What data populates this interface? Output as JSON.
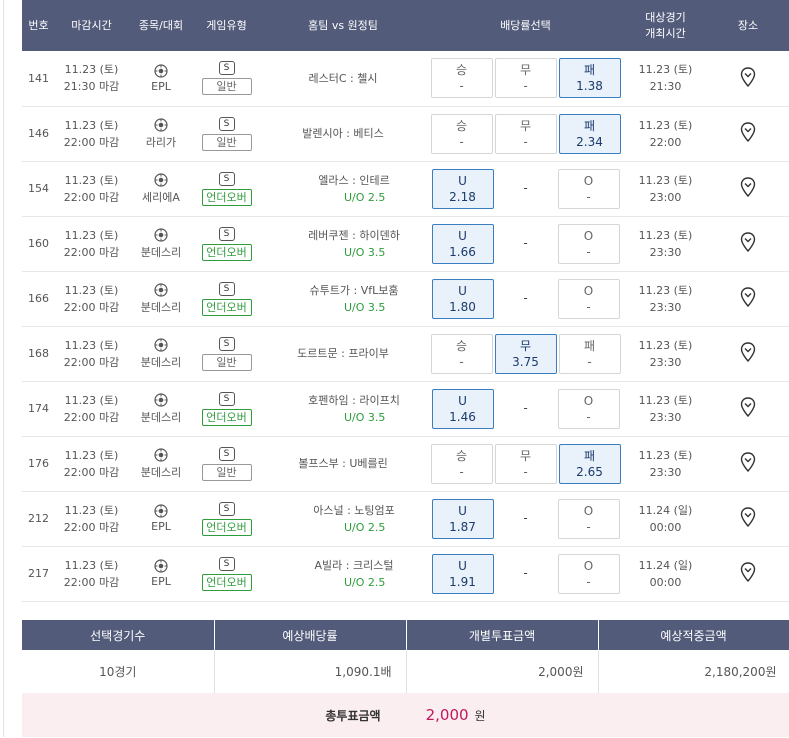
{
  "headers": [
    "번호",
    "마감시간",
    "종목/대회",
    "게임유형",
    "홈팀 vs 원정팀",
    "배당률선택",
    "대상경기\n개최시간",
    "장소"
  ],
  "rows": [
    {
      "no": "141",
      "date": "11.23 (토)",
      "close": "21:30 마감",
      "league": "EPL",
      "type": "일반",
      "match": "레스터C : 첼시",
      "uo": "",
      "odds": [
        {
          "label": "승",
          "value": "-",
          "sel": false
        },
        {
          "label": "무",
          "value": "-",
          "sel": false
        },
        {
          "label": "패",
          "value": "1.38",
          "sel": true
        }
      ],
      "game_date": "11.23 (토)",
      "game_time": "21:30"
    },
    {
      "no": "146",
      "date": "11.23 (토)",
      "close": "22:00 마감",
      "league": "라리가",
      "type": "일반",
      "match": "발렌시아 : 베티스",
      "uo": "",
      "odds": [
        {
          "label": "승",
          "value": "-",
          "sel": false
        },
        {
          "label": "무",
          "value": "-",
          "sel": false
        },
        {
          "label": "패",
          "value": "2.34",
          "sel": true
        }
      ],
      "game_date": "11.23 (토)",
      "game_time": "22:00"
    },
    {
      "no": "154",
      "date": "11.23 (토)",
      "close": "22:00 마감",
      "league": "세리에A",
      "type": "언더오버",
      "match": "엘라스 : 인테르",
      "uo": "U/O 2.5",
      "odds": [
        {
          "label": "U",
          "value": "2.18",
          "sel": true
        },
        {
          "label": "-",
          "value": "",
          "sel": false
        },
        {
          "label": "O",
          "value": "-",
          "sel": false
        }
      ],
      "game_date": "11.23 (토)",
      "game_time": "23:00"
    },
    {
      "no": "160",
      "date": "11.23 (토)",
      "close": "22:00 마감",
      "league": "분데스리",
      "type": "언더오버",
      "match": "레버쿠젠 : 하이덴하",
      "uo": "U/O 3.5",
      "odds": [
        {
          "label": "U",
          "value": "1.66",
          "sel": true
        },
        {
          "label": "-",
          "value": "",
          "sel": false
        },
        {
          "label": "O",
          "value": "-",
          "sel": false
        }
      ],
      "game_date": "11.23 (토)",
      "game_time": "23:30"
    },
    {
      "no": "166",
      "date": "11.23 (토)",
      "close": "22:00 마감",
      "league": "분데스리",
      "type": "언더오버",
      "match": "슈투트가 : VfL보훔",
      "uo": "U/O 3.5",
      "odds": [
        {
          "label": "U",
          "value": "1.80",
          "sel": true
        },
        {
          "label": "-",
          "value": "",
          "sel": false
        },
        {
          "label": "O",
          "value": "-",
          "sel": false
        }
      ],
      "game_date": "11.23 (토)",
      "game_time": "23:30"
    },
    {
      "no": "168",
      "date": "11.23 (토)",
      "close": "22:00 마감",
      "league": "분데스리",
      "type": "일반",
      "match": "도르트문 : 프라이부",
      "uo": "",
      "odds": [
        {
          "label": "승",
          "value": "-",
          "sel": false
        },
        {
          "label": "무",
          "value": "3.75",
          "sel": true
        },
        {
          "label": "패",
          "value": "-",
          "sel": false
        }
      ],
      "game_date": "11.23 (토)",
      "game_time": "23:30"
    },
    {
      "no": "174",
      "date": "11.23 (토)",
      "close": "22:00 마감",
      "league": "분데스리",
      "type": "언더오버",
      "match": "호펜하임 : 라이프치",
      "uo": "U/O 3.5",
      "odds": [
        {
          "label": "U",
          "value": "1.46",
          "sel": true
        },
        {
          "label": "-",
          "value": "",
          "sel": false
        },
        {
          "label": "O",
          "value": "-",
          "sel": false
        }
      ],
      "game_date": "11.23 (토)",
      "game_time": "23:30"
    },
    {
      "no": "176",
      "date": "11.23 (토)",
      "close": "22:00 마감",
      "league": "분데스리",
      "type": "일반",
      "match": "볼프스부 : U베를린",
      "uo": "",
      "odds": [
        {
          "label": "승",
          "value": "-",
          "sel": false
        },
        {
          "label": "무",
          "value": "-",
          "sel": false
        },
        {
          "label": "패",
          "value": "2.65",
          "sel": true
        }
      ],
      "game_date": "11.23 (토)",
      "game_time": "23:30"
    },
    {
      "no": "212",
      "date": "11.23 (토)",
      "close": "22:00 마감",
      "league": "EPL",
      "type": "언더오버",
      "match": "아스널 : 노팅엄포",
      "uo": "U/O 2.5",
      "odds": [
        {
          "label": "U",
          "value": "1.87",
          "sel": true
        },
        {
          "label": "-",
          "value": "",
          "sel": false
        },
        {
          "label": "O",
          "value": "-",
          "sel": false
        }
      ],
      "game_date": "11.24 (일)",
      "game_time": "00:00"
    },
    {
      "no": "217",
      "date": "11.23 (토)",
      "close": "22:00 마감",
      "league": "EPL",
      "type": "언더오버",
      "match": "A빌라 : 크리스털",
      "uo": "U/O 2.5",
      "odds": [
        {
          "label": "U",
          "value": "1.91",
          "sel": true
        },
        {
          "label": "-",
          "value": "",
          "sel": false
        },
        {
          "label": "O",
          "value": "-",
          "sel": false
        }
      ],
      "game_date": "11.24 (일)",
      "game_time": "00:00"
    }
  ],
  "s_mark": "S",
  "summary": {
    "headers": [
      "선택경기수",
      "예상배당률",
      "개별투표금액",
      "예상적중금액"
    ],
    "values": [
      "10경기",
      "1,090.1배",
      "2,000원",
      "2,180,200원"
    ]
  },
  "total": {
    "label": "총투표금액",
    "amount": "2,000",
    "unit": "원"
  },
  "colors": {
    "header_bg": "#535b7a",
    "selected_border": "#3b7ec0",
    "selected_bg": "#e9f2fb",
    "uo_green": "#2e9c3b",
    "total_amount": "#c2185b",
    "total_bg": "#fbeef1"
  }
}
